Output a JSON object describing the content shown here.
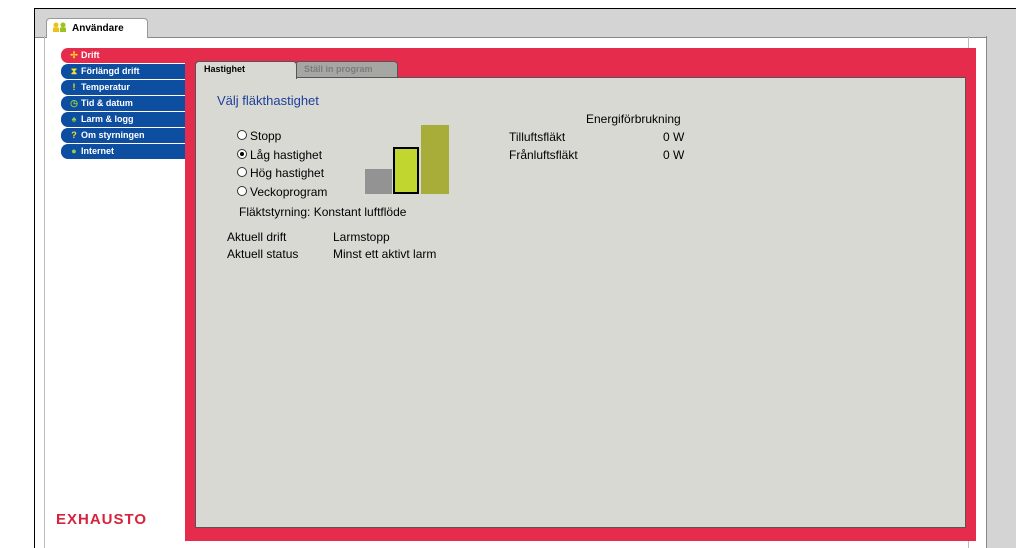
{
  "header": {
    "user_tab_label": "Användare"
  },
  "sidebar": {
    "items": [
      {
        "label": "Drift",
        "icon": "fan-icon",
        "active": true
      },
      {
        "label": "Förlängd drift",
        "icon": "hourglass-icon",
        "active": false
      },
      {
        "label": "Temperatur",
        "icon": "thermometer-icon",
        "active": false
      },
      {
        "label": "Tid & datum",
        "icon": "clock-icon",
        "active": false
      },
      {
        "label": "Larm & logg",
        "icon": "bell-icon",
        "active": false
      },
      {
        "label": "Om styrningen",
        "icon": "question-icon",
        "active": false
      },
      {
        "label": "Internet",
        "icon": "globe-icon",
        "active": false
      }
    ],
    "logo_text": "EXHAUSTO"
  },
  "tabs": [
    {
      "label": "Hastighet",
      "active": true
    },
    {
      "label": "Ställ in program",
      "active": false
    }
  ],
  "speed": {
    "title": "Välj fläkthastighet",
    "options": [
      {
        "label": "Stopp",
        "selected": false
      },
      {
        "label": "Låg hastighet",
        "selected": true
      },
      {
        "label": "Hög hastighet",
        "selected": false
      },
      {
        "label": "Veckoprogram",
        "selected": false
      }
    ],
    "fan_control": "Fläktstyrning: Konstant luftflöde",
    "level_indicator": {
      "levels": 3,
      "selected_level": 2
    }
  },
  "energy": {
    "title": "Energiförbrukning",
    "rows": [
      {
        "label": "Tilluftsfläkt",
        "value": "0 W"
      },
      {
        "label": "Frånluftsfläkt",
        "value": "0 W"
      }
    ]
  },
  "status": {
    "rows": [
      {
        "label": "Aktuell drift",
        "value": "Larmstopp"
      },
      {
        "label": "Aktuell status",
        "value": "Minst ett aktivt larm"
      }
    ]
  },
  "colors": {
    "red": "#e62c4c",
    "nav_blue": "#0d4ea0",
    "panel_gray": "#d9d9d4",
    "bar_low": "#c2d630",
    "bar_high": "#a7ad38",
    "bar_off": "#939393"
  }
}
